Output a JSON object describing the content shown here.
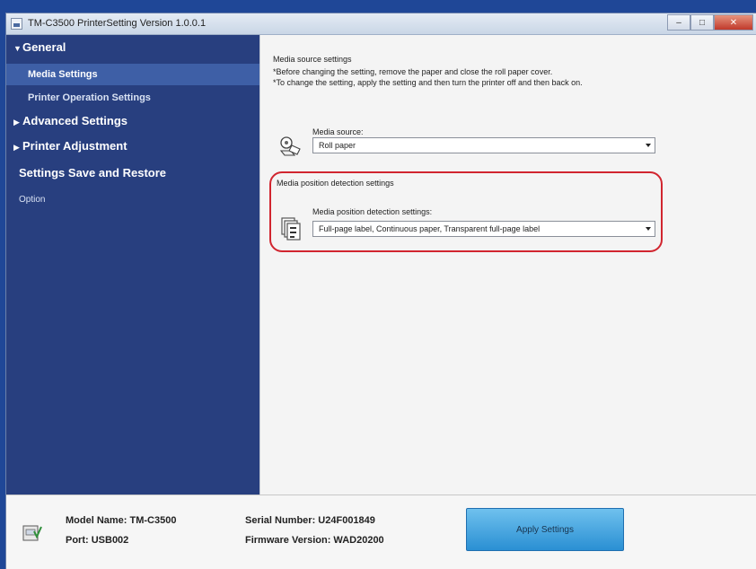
{
  "window": {
    "title": "TM-C3500 PrinterSetting Version 1.0.0.1",
    "minimize_glyph": "–",
    "maximize_glyph": "□",
    "close_glyph": "✕"
  },
  "sidebar": {
    "general": "General",
    "media_settings": "Media Settings",
    "printer_operation_settings": "Printer Operation Settings",
    "advanced_settings": "Advanced Settings",
    "printer_adjustment": "Printer Adjustment",
    "settings_save_restore": "Settings Save and Restore",
    "option": "Option",
    "expanded_arrow": "▼",
    "collapsed_arrow": "▶"
  },
  "main": {
    "media_source_section": "Media source settings",
    "note1": "*Before changing the setting, remove the paper and close the roll paper cover.",
    "note2": "*To change the setting, apply the setting and then turn the printer off and then back on.",
    "media_source_label": "Media source:",
    "media_source_value": "Roll paper",
    "detection_section": "Media position detection settings",
    "detection_label": "Media position detection settings:",
    "detection_value": "Full-page label, Continuous paper, Transparent full-page label"
  },
  "footer": {
    "model_name": "Model Name: TM-C3500",
    "port": "Port: USB002",
    "serial_number": "Serial Number: U24F001849",
    "firmware_version": "Firmware Version: WAD20200",
    "apply_button": "Apply Settings"
  },
  "colors": {
    "desktop": "#1f4797",
    "sidebar": "#283f7f",
    "selected_item": "#3e5fa6",
    "highlight_border": "#d1252f",
    "apply_button": "#2a8fd3"
  }
}
